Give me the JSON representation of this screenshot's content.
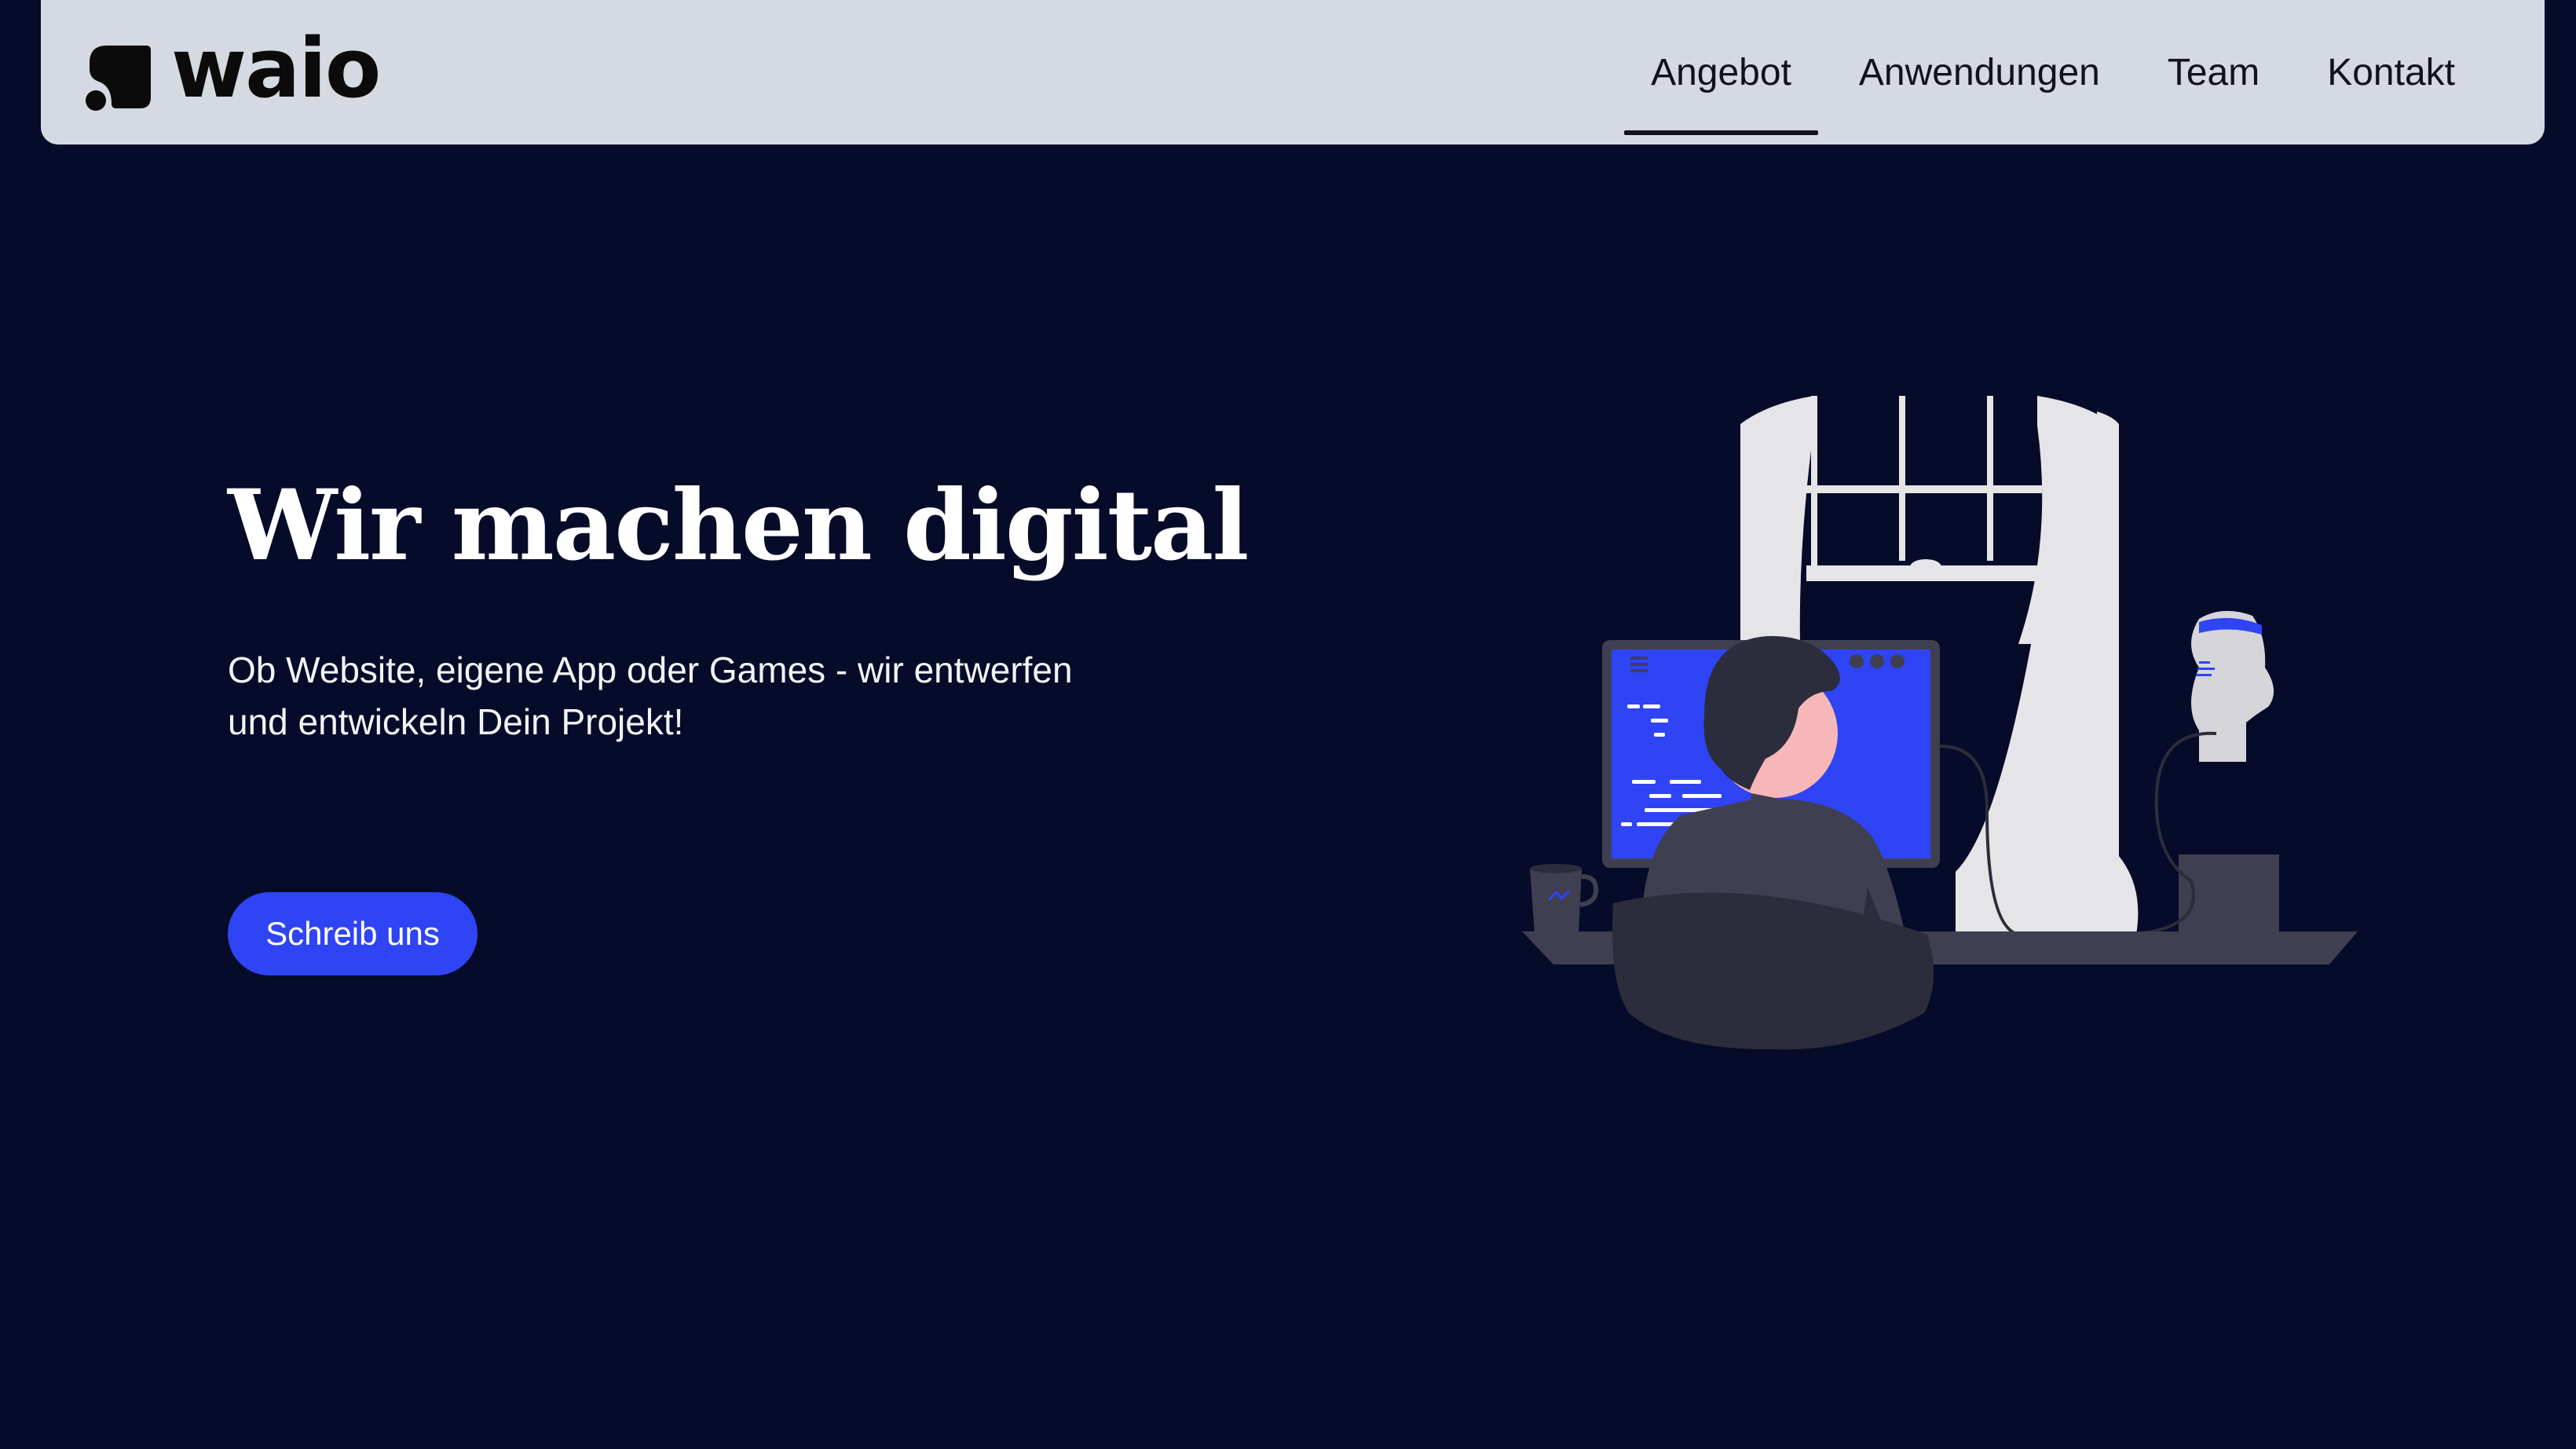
{
  "header": {
    "logo_text": "waio",
    "nav": [
      {
        "label": "Angebot",
        "active": true
      },
      {
        "label": "Anwendungen",
        "active": false
      },
      {
        "label": "Team",
        "active": false
      },
      {
        "label": "Kontakt",
        "active": false
      }
    ]
  },
  "hero": {
    "title": "Wir machen digital",
    "subtitle_line1": "Ob Website, eigene App oder Games - wir entwerfen",
    "subtitle_line2": "und entwickeln Dein Projekt!",
    "cta_label": "Schreib uns"
  },
  "colors": {
    "background": "#060b2a",
    "navbar": "#d5d9e2",
    "accent": "#2f44f5",
    "text_light": "#ffffff"
  },
  "illustration": {
    "description_icon": "developer-at-desk-illustration"
  }
}
